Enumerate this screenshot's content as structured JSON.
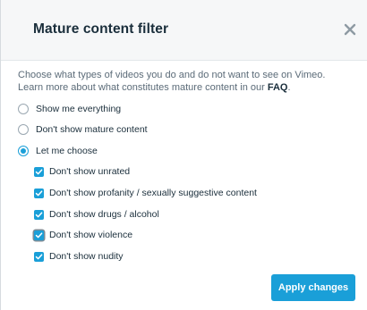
{
  "dialog": {
    "title": "Mature content filter",
    "close_icon": "close-icon",
    "description": "Choose what types of videos you do and do not want to see on Vimeo. Learn more about what constitutes mature content in our ",
    "faq_link": "FAQ",
    "description_end": "."
  },
  "options": {
    "radios": [
      {
        "label": "Show me everything",
        "checked": false
      },
      {
        "label": "Don't show mature content",
        "checked": false
      },
      {
        "label": "Let me choose",
        "checked": true
      }
    ],
    "checkboxes": [
      {
        "label": "Don't show unrated",
        "checked": true
      },
      {
        "label": "Don't show profanity / sexually suggestive content",
        "checked": true
      },
      {
        "label": "Don't show drugs / alcohol",
        "checked": true
      },
      {
        "label": "Don't show violence",
        "checked": true
      },
      {
        "label": "Don't show nudity",
        "checked": true
      }
    ]
  },
  "footer": {
    "apply_label": "Apply changes"
  },
  "colors": {
    "accent": "#1a9fd8",
    "title": "#1a2e3b",
    "header_bg": "#f6f7f8",
    "text_muted": "#5b6b78"
  }
}
